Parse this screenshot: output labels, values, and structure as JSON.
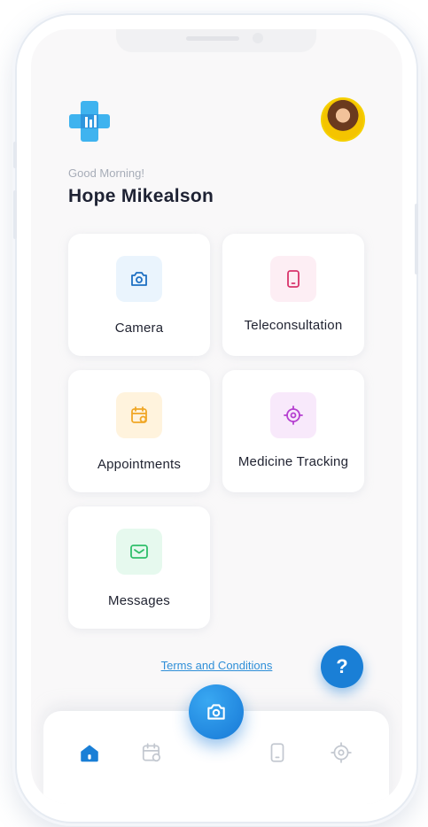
{
  "header": {
    "greeting": "Good Morning!",
    "user_name": "Hope Mikealson",
    "logo_icon": "medical-cross-logo-icon",
    "avatar_icon": "user-avatar"
  },
  "dashboard": {
    "cards": [
      {
        "label": "Camera",
        "icon": "camera-icon",
        "tile_color": "#eaf4fd",
        "icon_color": "#1d6fc2"
      },
      {
        "label": "Teleconsultation",
        "icon": "phone-icon",
        "tile_color": "#fdeef4",
        "icon_color": "#d8336b"
      },
      {
        "label": "Appointments",
        "icon": "calendar-icon",
        "tile_color": "#fff3dd",
        "icon_color": "#f0a726"
      },
      {
        "label": "Medicine Tracking",
        "icon": "target-icon",
        "tile_color": "#f8e9fb",
        "icon_color": "#b53fd0"
      },
      {
        "label": "Messages",
        "icon": "mail-icon",
        "tile_color": "#e6f9ee",
        "icon_color": "#2fbf6a"
      }
    ]
  },
  "footer": {
    "terms_label": "Terms and Conditions",
    "help_label": "?"
  },
  "bottom_nav": {
    "items": [
      {
        "icon": "home-icon",
        "active": true
      },
      {
        "icon": "calendar-icon",
        "active": false
      },
      {
        "icon": "camera-icon",
        "active": false
      },
      {
        "icon": "phone-icon",
        "active": false
      },
      {
        "icon": "target-icon",
        "active": false
      }
    ],
    "active_color": "#1a7fd6",
    "inactive_color": "#c3c8d0"
  }
}
